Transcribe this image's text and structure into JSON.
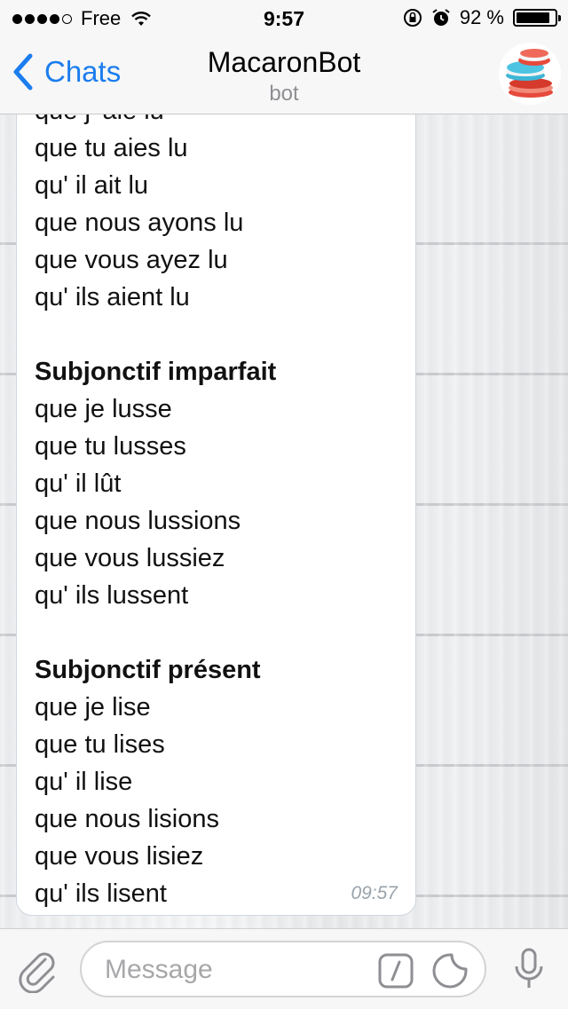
{
  "status_bar": {
    "carrier": "Free",
    "time": "9:57",
    "battery_percent": "92 %",
    "battery_level": 0.92
  },
  "nav": {
    "back_label": "Chats",
    "title": "MacaronBot",
    "subtitle": "bot"
  },
  "message": {
    "cut_line": "que j' aie lu",
    "lines_top": [
      "que tu aies lu",
      "qu' il ait lu",
      "que nous ayons lu",
      "que vous ayez lu",
      "qu' ils aient lu"
    ],
    "section1_heading": "Subjonctif imparfait",
    "section1_lines": [
      "que je lusse",
      "que tu lusses",
      "qu' il lût",
      "que nous lussions",
      "que vous lussiez",
      "qu' ils lussent"
    ],
    "section2_heading": "Subjonctif présent",
    "section2_lines": [
      "que je lise",
      "que tu lises",
      "qu' il lise",
      "que nous lisions",
      "que vous lisiez",
      "qu' ils lisent"
    ],
    "time": "09:57"
  },
  "input": {
    "placeholder": "Message"
  },
  "icons": {
    "back": "chevron-left-icon",
    "attach": "paperclip-icon",
    "commands": "slash-command-icon",
    "sticker": "sticker-icon",
    "mic": "microphone-icon"
  },
  "colors": {
    "accent": "#1b7dee",
    "bar_bg": "#f7f7f7",
    "bubble_bg": "#ffffff"
  }
}
